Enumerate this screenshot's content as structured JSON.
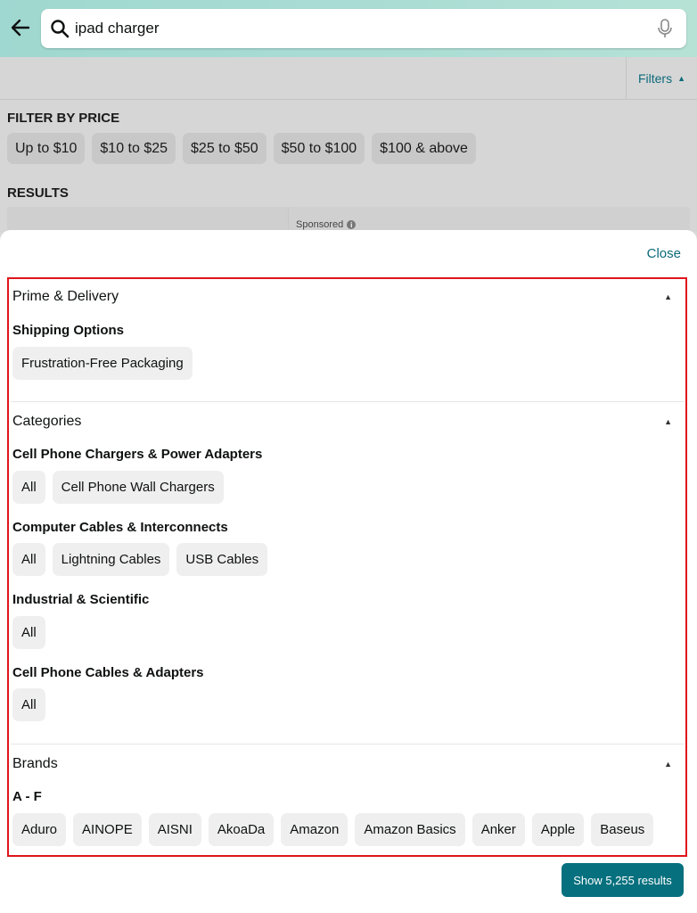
{
  "search": {
    "query": "ipad charger"
  },
  "filters_button": {
    "label": "Filters"
  },
  "filter_by_price": {
    "heading": "FILTER BY PRICE",
    "options": [
      "Up to $10",
      "$10 to $25",
      "$25 to $50",
      "$50 to $100",
      "$100 & above"
    ]
  },
  "results": {
    "heading": "RESULTS",
    "sponsored": "Sponsored"
  },
  "sheet": {
    "close_label": "Close",
    "prime_delivery": {
      "heading": "Prime & Delivery",
      "shipping_heading": "Shipping Options",
      "shipping_options": [
        "Frustration-Free Packaging"
      ]
    },
    "categories": {
      "heading": "Categories",
      "groups": [
        {
          "name": "Cell Phone Chargers & Power Adapters",
          "options": [
            "All",
            "Cell Phone Wall Chargers"
          ]
        },
        {
          "name": "Computer Cables & Interconnects",
          "options": [
            "All",
            "Lightning Cables",
            "USB Cables"
          ]
        },
        {
          "name": "Industrial & Scientific",
          "options": [
            "All"
          ]
        },
        {
          "name": "Cell Phone Cables & Adapters",
          "options": [
            "All"
          ]
        }
      ]
    },
    "brands": {
      "heading": "Brands",
      "range_heading": "A - F",
      "options": [
        "Aduro",
        "AINOPE",
        "AISNI",
        "AkoaDa",
        "Amazon",
        "Amazon Basics",
        "Anker",
        "Apple",
        "Baseus"
      ]
    },
    "show_results_label": "Show 5,255 results"
  },
  "colors": {
    "accent": "#06707e",
    "link": "#0b6a7a",
    "highlight": "#e0151b"
  }
}
